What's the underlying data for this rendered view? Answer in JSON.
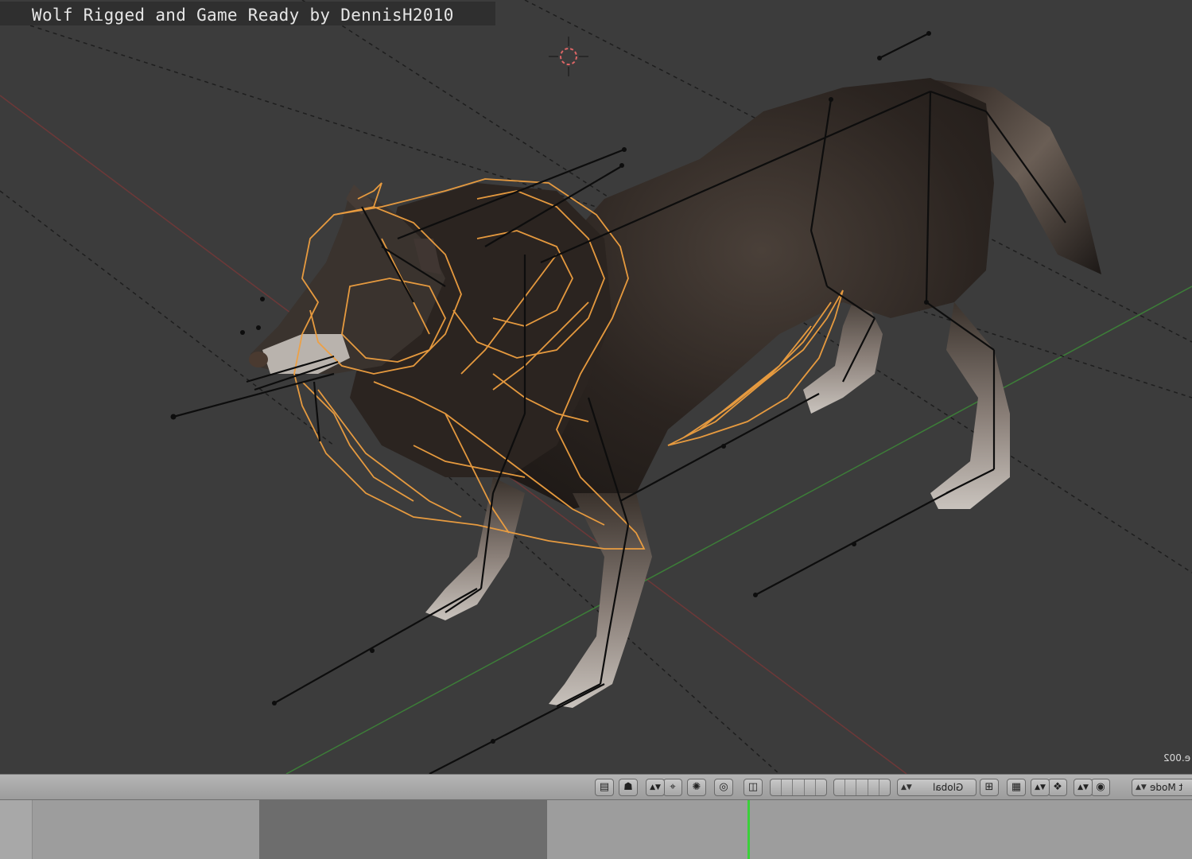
{
  "caption": "Wolf Rigged and Game Ready by DennisH2010",
  "viewport": {
    "object_name": "e.002"
  },
  "header": {
    "transform_orientation": "Global",
    "mode_label": "t Mode"
  },
  "icons": {
    "cursor": "3d-cursor-icon",
    "camera": "camera-icon",
    "snap": "snap-magnet-icon",
    "proportional": "proportional-edit-icon",
    "layers": "layer-grid-icon",
    "manipulator": "manipulator-icon",
    "shading": "viewport-shading-icon",
    "pivot": "pivot-point-icon",
    "render": "render-icon"
  },
  "colors": {
    "viewport_bg": "#3c3c3c",
    "selection_wire": "#f0a040",
    "x_axis": "#8a3a3a",
    "y_axis": "#3f8f3a",
    "playhead": "#3ad03a",
    "header_bg": "#a8a8a8",
    "timeline_bg": "#9d9d9d"
  },
  "timeline": {
    "current_frame_marker": "playhead"
  }
}
